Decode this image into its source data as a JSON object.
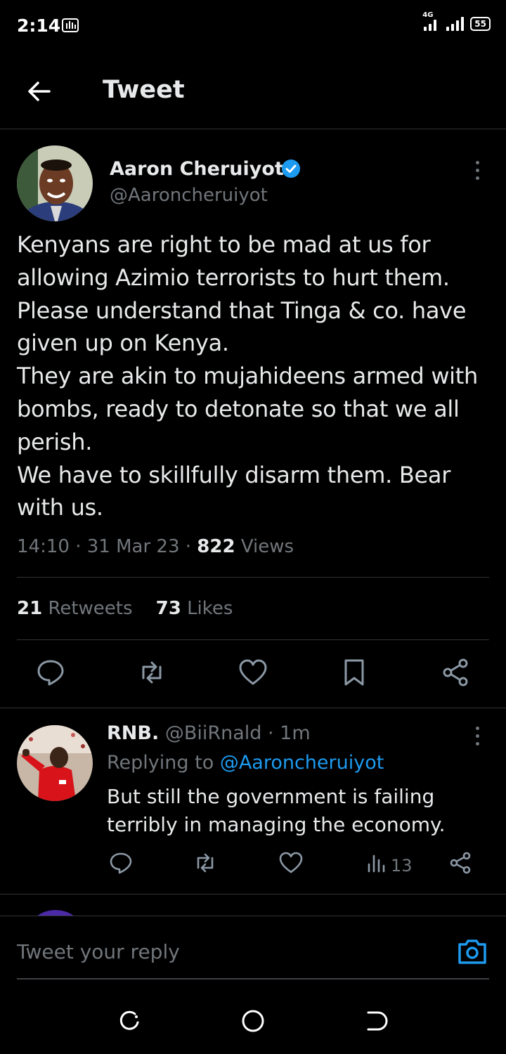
{
  "status_bar": {
    "time": "2:14",
    "network": "4G",
    "battery": "55"
  },
  "header": {
    "title": "Tweet"
  },
  "tweet": {
    "author_name": "Aaron Cheruiyot",
    "author_handle": "@Aaroncheruiyot",
    "text": "Kenyans are right to be mad at us for allowing Azimio terrorists to hurt them. Please understand that Tinga & co. have given up on Kenya.\nThey are akin to mujahideens  armed with bombs, ready to detonate so that we all perish.\nWe have to skillfully disarm them. Bear with us.",
    "time": "14:10",
    "date": "31 Mar 23",
    "views_count": "822",
    "views_label": "Views",
    "retweets_count": "21",
    "retweets_label": "Retweets",
    "likes_count": "73",
    "likes_label": "Likes"
  },
  "reply": {
    "name": "RNB.",
    "handle": "@BiiRnald",
    "age": "1m",
    "replying_prefix": "Replying to",
    "replying_to": "@Aaroncheruiyot",
    "text": "But still the government is failing terribly in managing the economy.",
    "views": "13"
  },
  "composer": {
    "placeholder": "Tweet your reply"
  },
  "colors": {
    "accent": "#1d9bf0",
    "background": "#000000",
    "muted": "#71767b",
    "text": "#e7e9ea"
  },
  "icons": [
    "back-arrow-icon",
    "verified-badge-icon",
    "more-vertical-icon",
    "reply-icon",
    "retweet-icon",
    "like-icon",
    "bookmark-icon",
    "share-icon",
    "views-icon",
    "camera-icon"
  ]
}
